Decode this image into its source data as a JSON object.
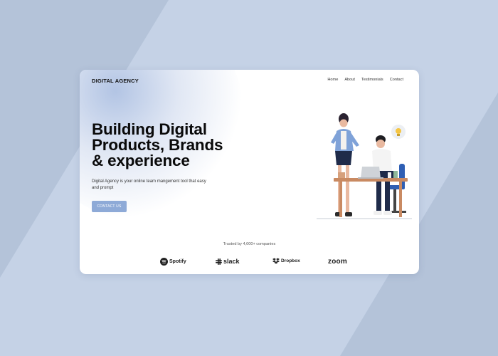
{
  "header": {
    "logo_text": "DIGITAL AGENCY",
    "nav": [
      {
        "label": "Home"
      },
      {
        "label": "About"
      },
      {
        "label": "Testimonials"
      },
      {
        "label": "Contact"
      }
    ]
  },
  "hero": {
    "title_lines": [
      "Building Digital",
      "Products, Brands",
      "& experience"
    ],
    "subtitle": "Digital Agency is your online team mangement tool that easy and prompt",
    "cta_label": "CONTACT US"
  },
  "trusted": {
    "text": "Trusted by 4,000+ companies",
    "brands": [
      {
        "name": "Spotify",
        "icon": "spotify-icon"
      },
      {
        "name": "slack",
        "icon": "slack-icon"
      },
      {
        "name": "Dropbox",
        "icon": "dropbox-icon"
      },
      {
        "name": "zoom",
        "icon": "none"
      }
    ]
  },
  "colors": {
    "page_background": "#c5d2e6",
    "accent": "#8eaad7",
    "text": "#0a0a0a"
  },
  "illustration": {
    "description_icon": "team-at-desk-icon",
    "bubble_icon": "lightbulb-icon"
  }
}
